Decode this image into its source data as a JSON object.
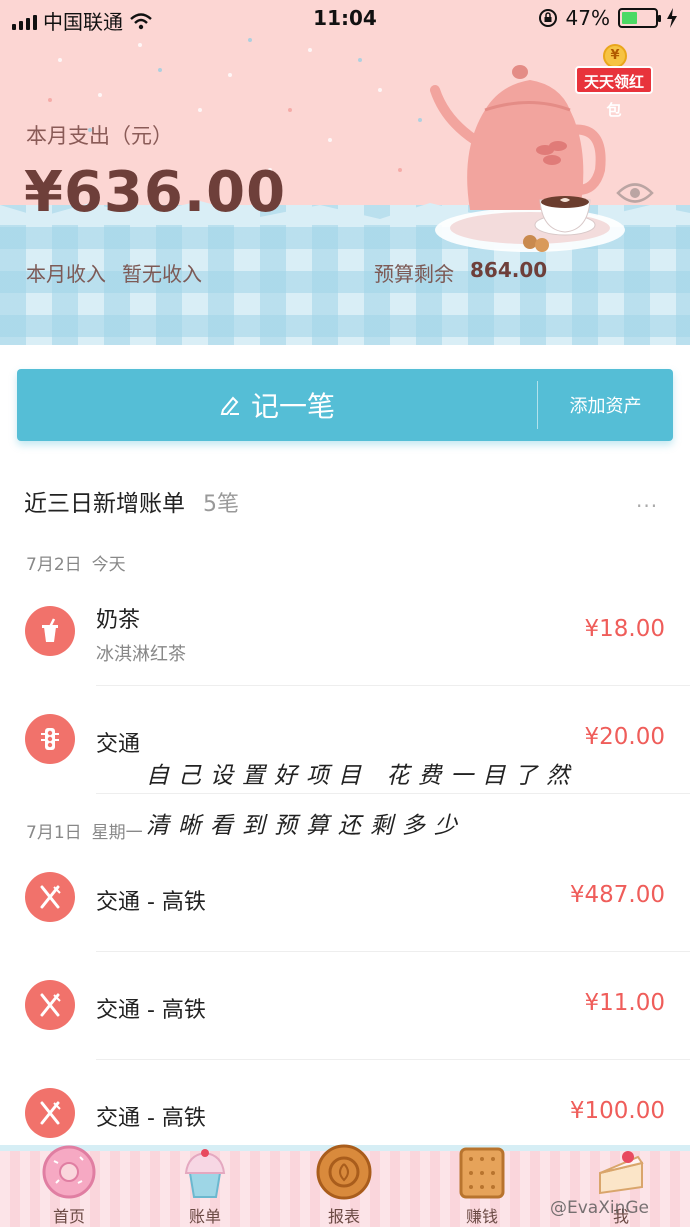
{
  "status_bar": {
    "carrier": "中国联通",
    "time": "11:04",
    "battery": "47%"
  },
  "header": {
    "expense_label": "本月支出（元）",
    "expense_amount": "¥636.00",
    "income_label": "本月收入",
    "income_value": "暂无收入",
    "budget_label": "预算剩余",
    "budget_value": "864.00",
    "red_packet_label": "天天领红包"
  },
  "actions": {
    "record_label": "记一笔",
    "add_asset_label": "添加资产"
  },
  "recent": {
    "title": "近三日新增账单",
    "count": "5笔",
    "more": "···",
    "groups": [
      {
        "date": "7月2日",
        "weekday": "今天",
        "items": [
          {
            "name": "奶茶",
            "note": "冰淇淋红茶",
            "amount": "¥18.00",
            "icon": "milk-tea-icon"
          },
          {
            "name": "交通",
            "note": "",
            "amount": "¥20.00",
            "icon": "traffic-light-icon"
          }
        ]
      },
      {
        "date": "7月1日",
        "weekday": "星期一",
        "items": [
          {
            "name": "交通 - 高铁",
            "note": "",
            "amount": "¥487.00",
            "icon": "fork-knife-icon"
          },
          {
            "name": "交通 - 高铁",
            "note": "",
            "amount": "¥11.00",
            "icon": "fork-knife-icon"
          },
          {
            "name": "交通 - 高铁",
            "note": "",
            "amount": "¥100.00",
            "icon": "fork-knife-icon"
          }
        ]
      }
    ]
  },
  "handwritten_notes": [
    "自己设置好项目  花费一目了然",
    "清晰看到预算还剩多少"
  ],
  "tabs": [
    {
      "label": "首页",
      "icon": "donut-icon"
    },
    {
      "label": "账单",
      "icon": "cupcake-icon"
    },
    {
      "label": "报表",
      "icon": "mooncake-icon"
    },
    {
      "label": "赚钱",
      "icon": "biscuit-icon"
    },
    {
      "label": "我",
      "icon": "cake-slice-icon"
    }
  ],
  "watermark": "@EvaXinGe",
  "colors": {
    "header_pink": "#fcd6d3",
    "accent_blue": "#55bed6",
    "amount_red": "#ef5d5a",
    "icon_coral": "#f1726b"
  }
}
